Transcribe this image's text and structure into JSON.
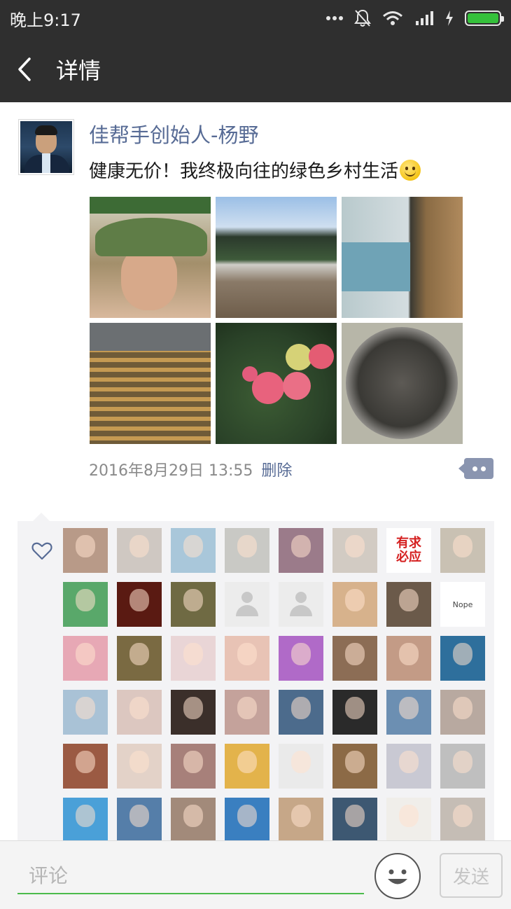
{
  "status_bar": {
    "time": "晚上9:17"
  },
  "nav": {
    "title": "详情"
  },
  "post": {
    "author": "佳帮手创始人-杨野",
    "text": "健康无价！我终极向往的绿色乡村生活",
    "timestamp": "2016年8月29日 13:55",
    "delete_label": "删除",
    "photo_count": 6
  },
  "likes": {
    "avatars": [
      {
        "kind": "photo",
        "color": "#b89a88"
      },
      {
        "kind": "photo",
        "color": "#cfc8c2"
      },
      {
        "kind": "photo",
        "color": "#a9c7da"
      },
      {
        "kind": "photo",
        "color": "#c9c9c5"
      },
      {
        "kind": "photo",
        "color": "#9b7b8a"
      },
      {
        "kind": "photo",
        "color": "#d2cbc3"
      },
      {
        "kind": "text",
        "text": "有求\n必应",
        "color": "#ffffff"
      },
      {
        "kind": "photo",
        "color": "#c9c1b3"
      },
      {
        "kind": "photo",
        "color": "#59a86a"
      },
      {
        "kind": "photo",
        "color": "#5a1a12"
      },
      {
        "kind": "photo",
        "color": "#6f6a43"
      },
      {
        "kind": "placeholder"
      },
      {
        "kind": "placeholder"
      },
      {
        "kind": "photo",
        "color": "#d7b28c"
      },
      {
        "kind": "photo",
        "color": "#6b5a4a"
      },
      {
        "kind": "text",
        "text": "Nope",
        "color": "#ffffff"
      },
      {
        "kind": "photo",
        "color": "#e7a8b5"
      },
      {
        "kind": "photo",
        "color": "#7a6a42"
      },
      {
        "kind": "photo",
        "color": "#e9d5d6"
      },
      {
        "kind": "photo",
        "color": "#e8c3b5"
      },
      {
        "kind": "photo",
        "color": "#b06ac8"
      },
      {
        "kind": "photo",
        "color": "#8c6d55"
      },
      {
        "kind": "photo",
        "color": "#c39b86"
      },
      {
        "kind": "photo",
        "color": "#2e6f9c"
      },
      {
        "kind": "photo",
        "color": "#a9c2d6"
      },
      {
        "kind": "photo",
        "color": "#dcc7c0"
      },
      {
        "kind": "photo",
        "color": "#3b2f2a"
      },
      {
        "kind": "photo",
        "color": "#c4a29b"
      },
      {
        "kind": "photo",
        "color": "#4c6b8c"
      },
      {
        "kind": "photo",
        "color": "#2a2a2a"
      },
      {
        "kind": "photo",
        "color": "#6c8fb2"
      },
      {
        "kind": "photo",
        "color": "#b8a9a0"
      },
      {
        "kind": "photo",
        "color": "#9b5a43"
      },
      {
        "kind": "photo",
        "color": "#e3d2c8"
      },
      {
        "kind": "photo",
        "color": "#a7807a"
      },
      {
        "kind": "photo",
        "color": "#e3b34b"
      },
      {
        "kind": "photo",
        "color": "#eaeaea"
      },
      {
        "kind": "photo",
        "color": "#8c6a46"
      },
      {
        "kind": "photo",
        "color": "#c9c9d3"
      },
      {
        "kind": "photo",
        "color": "#bfbfbf"
      },
      {
        "kind": "photo",
        "color": "#4aa0d8"
      },
      {
        "kind": "photo",
        "color": "#557ea9"
      },
      {
        "kind": "photo",
        "color": "#a28a7a"
      },
      {
        "kind": "photo",
        "color": "#3a7fc0"
      },
      {
        "kind": "photo",
        "color": "#c6a788"
      },
      {
        "kind": "photo",
        "color": "#3d5872"
      },
      {
        "kind": "photo",
        "color": "#f0eeea"
      },
      {
        "kind": "photo",
        "color": "#c5bdb5"
      }
    ]
  },
  "input_bar": {
    "placeholder": "评论",
    "send_label": "发送"
  },
  "colors": {
    "link": "#576b95",
    "nav_bg": "#2f2f2f",
    "accent_green": "#4bbb4b"
  }
}
